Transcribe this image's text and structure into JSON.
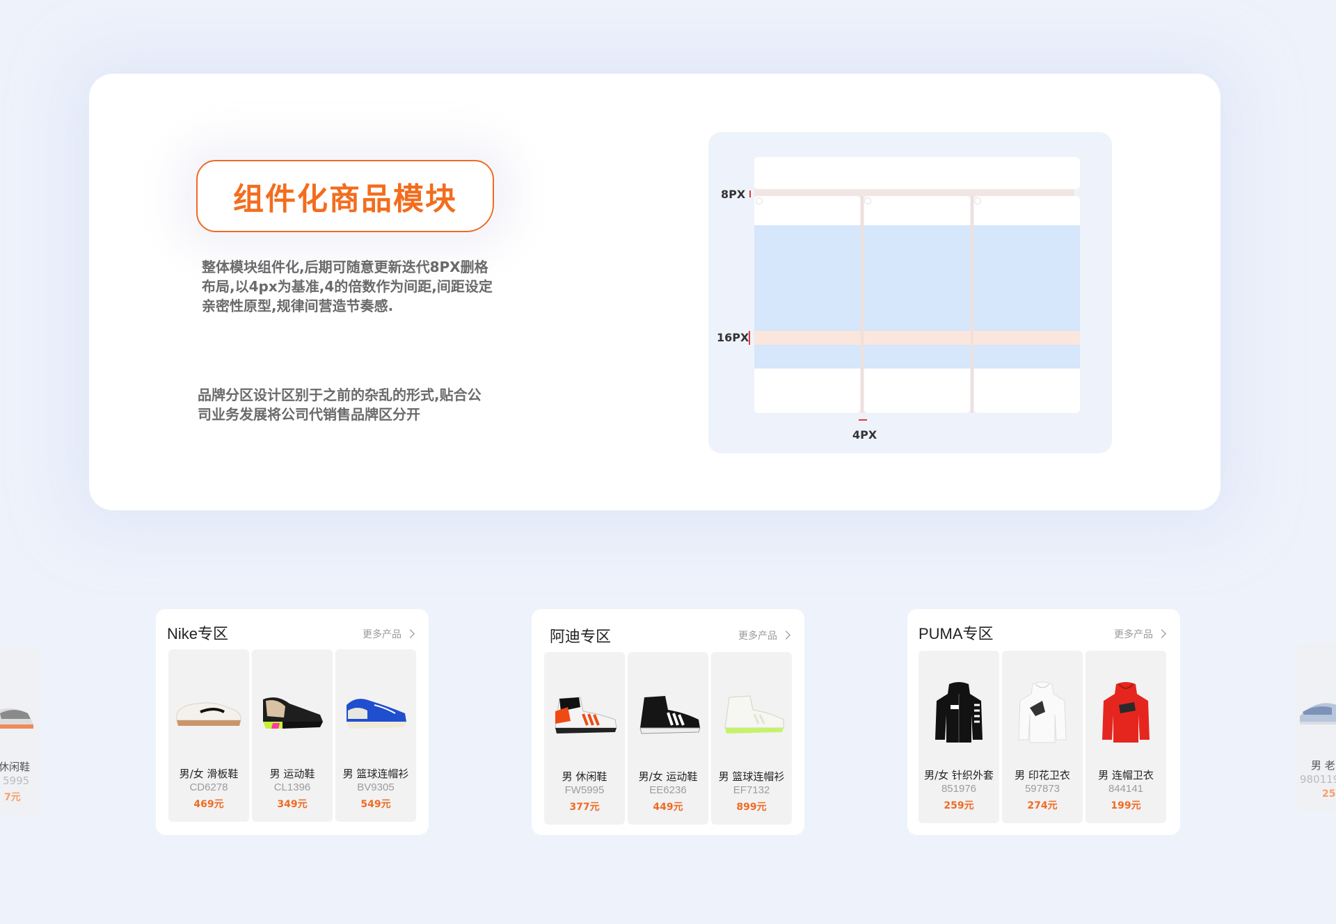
{
  "header": {
    "title": "组件化商品模块",
    "desc1": "整体模块组件化,后期可随意更新迭代8PX删格布局,以4px为基准,4的倍数作为间距,间距设定亲密性原型,规律间营造节奏感.",
    "desc2": "品牌分区设计区别于之前的杂乱的形式,贴合公司业务发展将公司代销售品牌区分开"
  },
  "diagram": {
    "label_8px": "8PX",
    "label_16px": "16PX",
    "label_4px": "4PX"
  },
  "sections": [
    {
      "title": "Nike专区",
      "more": "更多产品",
      "items": [
        {
          "name": "男/女 滑板鞋",
          "code": "CD6278",
          "price": "469元",
          "icon": "white-skate-shoe"
        },
        {
          "name": "男 运动鞋",
          "code": "CL1396",
          "price": "349元",
          "icon": "black-basketball-shoe"
        },
        {
          "name": "男 篮球连帽衫",
          "code": "BV9305",
          "price": "549元",
          "icon": "blue-basketball-shoe"
        }
      ]
    },
    {
      "title": "阿迪专区",
      "more": "更多产品",
      "items": [
        {
          "name": "男 休闲鞋",
          "code": "FW5995",
          "price": "377元",
          "icon": "orange-high-top"
        },
        {
          "name": "男/女 运动鞋",
          "code": "EE6236",
          "price": "449元",
          "icon": "black-high-top"
        },
        {
          "name": "男 篮球连帽衫",
          "code": "EF7132",
          "price": "899元",
          "icon": "white-green-high-top"
        }
      ]
    },
    {
      "title": "PUMA专区",
      "more": "更多产品",
      "items": [
        {
          "name": "男/女 针织外套",
          "code": "851976",
          "price": "259元",
          "icon": "black-jacket"
        },
        {
          "name": "男 印花卫衣",
          "code": "597873",
          "price": "274元",
          "icon": "white-hoodie"
        },
        {
          "name": "男 连帽卫衣",
          "code": "844141",
          "price": "199元",
          "icon": "red-hoodie"
        }
      ]
    }
  ],
  "side_left": {
    "name": "休闲鞋",
    "code": "5995",
    "price": "7元"
  },
  "side_right": {
    "name": "男 老",
    "code": "980119",
    "price": "25"
  },
  "colors": {
    "accent": "#f26d1e",
    "background": "#eef2fb"
  }
}
